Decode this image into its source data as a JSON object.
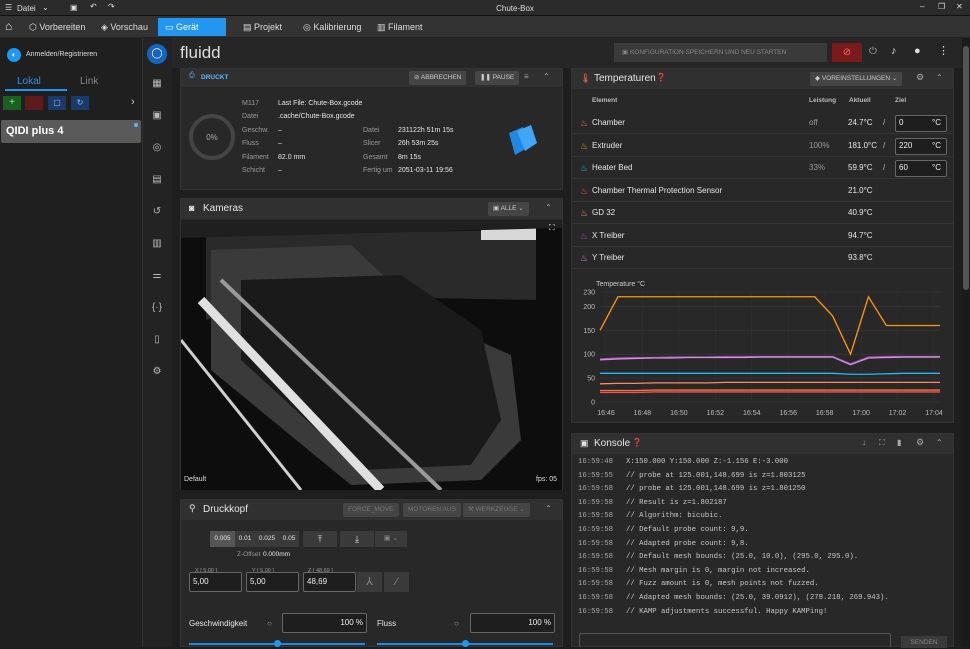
{
  "window": {
    "title": "Chute-Box",
    "file_menu": "Datei"
  },
  "menubar": {
    "tabs": [
      {
        "label": "Vorbereiten"
      },
      {
        "label": "Vorschau"
      },
      {
        "label": "Gerät"
      },
      {
        "label": "Projekt"
      },
      {
        "label": "Kalibrierung"
      },
      {
        "label": "Filament"
      }
    ]
  },
  "sidebar": {
    "login": "Anmelden/Registrieren",
    "tab_local": "Lokal",
    "tab_link": "Link",
    "printer_name": "QIDI plus 4"
  },
  "topbar": {
    "brand": "fluidd",
    "save_restart": "KONFIGURATION SPEICHERN UND NEU STARTEN"
  },
  "status": {
    "state": "DRUCKT",
    "cancel": "ABBRECHEN",
    "pause": "PAUSE",
    "progress": "0%",
    "progress_value": 0,
    "filename_code": "M117",
    "last_file": "Last File: Chute-Box.gcode",
    "file_label": "Datei",
    "file_value": ".cache/Chute-Box.gcode",
    "left": [
      {
        "label": "Geschw.",
        "value": "–"
      },
      {
        "label": "Fluss",
        "value": "–"
      },
      {
        "label": "Filament",
        "value": "82.0 mm"
      },
      {
        "label": "Schicht",
        "value": "–"
      }
    ],
    "right": [
      {
        "label": "Datei",
        "value": "231122h 51m 15s"
      },
      {
        "label": "Slicer",
        "value": "26h 53m 25s"
      },
      {
        "label": "Gesamt",
        "value": "8m 15s"
      },
      {
        "label": "Fertig um",
        "value": "2051-03-11 19:56"
      }
    ]
  },
  "cameras": {
    "title": "Kameras",
    "filter": "ALLE",
    "camera_name": "Default",
    "fps": "fps: 05"
  },
  "toolhead": {
    "title": "Druckkopf",
    "force_move": "FORCE_MOVE",
    "motors_off": "MOTOREN AUS",
    "tools": "WERKZEUGE",
    "steps": [
      "0.005",
      "0.01",
      "0.025",
      "0.05"
    ],
    "zoffset_label": "Z-Offset",
    "zoffset_value": "0.000mm",
    "x_label": "X [ 5.00 ]",
    "x_value": "5,00",
    "y_label": "Y [ 5.00 ]",
    "y_value": "5,00",
    "z_label": "Z [ 48.69 ]",
    "z_value": "48,69",
    "speed_label": "Geschwindigkeit",
    "speed_value": "100 %",
    "flow_label": "Fluss",
    "flow_value": "100 %"
  },
  "temps": {
    "title": "Temperaturen",
    "presets": "VOREINSTELLUNGEN",
    "head": {
      "name": "Element",
      "power": "Leistung",
      "actual": "Aktuell",
      "target": "Ziel"
    },
    "rows": [
      {
        "name": "Chamber",
        "power": "off",
        "actual": "24.7°C",
        "target": "0",
        "unit": "°C",
        "color": "#ff7043"
      },
      {
        "name": "Extruder",
        "power": "100%",
        "actual": "181.0°C",
        "target": "220",
        "unit": "°C",
        "color": "#ff9800"
      },
      {
        "name": "Heater Bed",
        "power": "33%",
        "actual": "59.9°C",
        "target": "60",
        "unit": "°C",
        "color": "#29b6f6"
      },
      {
        "name": "Chamber Thermal Protection Sensor",
        "power": "",
        "actual": "21.0°C",
        "target": "",
        "unit": "",
        "color": "#ef5350"
      },
      {
        "name": "GD 32",
        "power": "",
        "actual": "40.9°C",
        "target": "",
        "unit": "",
        "color": "#ff8a65"
      },
      {
        "name": "X Treiber",
        "power": "",
        "actual": "94.7°C",
        "target": "",
        "unit": "",
        "color": "#ab47bc"
      },
      {
        "name": "Y Treiber",
        "power": "",
        "actual": "93.8°C",
        "target": "",
        "unit": "",
        "color": "#ce93d8"
      }
    ]
  },
  "chart_data": {
    "type": "line",
    "ylabel": "Temperature °C",
    "x_ticks": [
      "16:46",
      "16:48",
      "16:50",
      "16:52",
      "16:54",
      "16:56",
      "16:58",
      "17:00",
      "17:02",
      "17:04"
    ],
    "y_ticks": [
      0,
      50,
      100,
      150,
      200,
      230
    ],
    "ylim": [
      0,
      230
    ],
    "grid": true,
    "x": [
      0,
      1,
      2,
      3,
      4,
      5,
      6,
      7,
      8,
      9,
      10,
      11,
      12,
      13,
      14,
      15,
      16,
      17,
      18,
      19
    ],
    "series": [
      {
        "name": "Extruder",
        "color": "#ff9800",
        "values": [
          150,
          220,
          220,
          220,
          220,
          220,
          220,
          220,
          220,
          220,
          220,
          220,
          220,
          180,
          100,
          220,
          160,
          160,
          160,
          160
        ]
      },
      {
        "name": "Heater Bed",
        "color": "#29b6f6",
        "values": [
          60,
          60,
          60,
          60,
          60,
          60,
          60,
          60,
          60,
          60,
          60,
          60,
          60,
          60,
          58,
          58,
          59,
          60,
          60,
          60
        ]
      },
      {
        "name": "X Treiber",
        "color": "#ab47bc",
        "values": [
          90,
          92,
          93,
          93,
          94,
          94,
          94,
          95,
          95,
          95,
          95,
          95,
          95,
          95,
          80,
          94,
          95,
          95,
          95,
          95
        ]
      },
      {
        "name": "Y Treiber",
        "color": "#ce93d8",
        "values": [
          88,
          90,
          91,
          92,
          92,
          93,
          93,
          93,
          93,
          94,
          94,
          94,
          94,
          94,
          78,
          92,
          93,
          94,
          94,
          94
        ]
      },
      {
        "name": "GD 32",
        "color": "#ff8a65",
        "values": [
          38,
          39,
          39,
          40,
          40,
          40,
          40,
          41,
          41,
          41,
          41,
          41,
          41,
          41,
          41,
          41,
          41,
          41,
          41,
          41
        ]
      },
      {
        "name": "Chamber",
        "color": "#ff7043",
        "values": [
          24,
          24,
          24,
          25,
          25,
          25,
          25,
          25,
          25,
          25,
          25,
          25,
          25,
          25,
          25,
          25,
          25,
          25,
          25,
          25
        ]
      },
      {
        "name": "Chamber Thermal Protection Sensor",
        "color": "#ef5350",
        "values": [
          20,
          20,
          20,
          21,
          21,
          21,
          21,
          21,
          21,
          21,
          21,
          21,
          21,
          21,
          21,
          21,
          21,
          21,
          21,
          21
        ]
      }
    ]
  },
  "console": {
    "title": "Konsole",
    "send": "SENDEN",
    "lines": [
      {
        "t": "16:59:48",
        "m": "X:150.000 Y:150.000 Z:-1.156 E:-3.000"
      },
      {
        "t": "16:59:55",
        "m": "// probe at 125.001,148.699 is z=1.803125"
      },
      {
        "t": "16:59:58",
        "m": "// probe at 125.001,148.699 is z=1.801250"
      },
      {
        "t": "16:59:58",
        "m": "// Result is z=1.802187"
      },
      {
        "t": "16:59:58",
        "m": "// Algorithm: bicubic."
      },
      {
        "t": "16:59:58",
        "m": "// Default probe count: 9,9."
      },
      {
        "t": "16:59:58",
        "m": "// Adapted probe count: 9,8."
      },
      {
        "t": "16:59:58",
        "m": "// Default mesh bounds: (25.0, 10.0), (295.0, 295.0)."
      },
      {
        "t": "16:59:58",
        "m": "// Mesh margin is 0, margin not increased."
      },
      {
        "t": "16:59:58",
        "m": "// Fuzz amount is 0, mesh points not fuzzed."
      },
      {
        "t": "16:59:58",
        "m": "// Adapted mesh bounds: (25.0, 39.0912), (278.218, 269.943)."
      },
      {
        "t": "16:59:58",
        "m": "// KAMP adjustments successful. Happy KAMPing!"
      }
    ]
  }
}
